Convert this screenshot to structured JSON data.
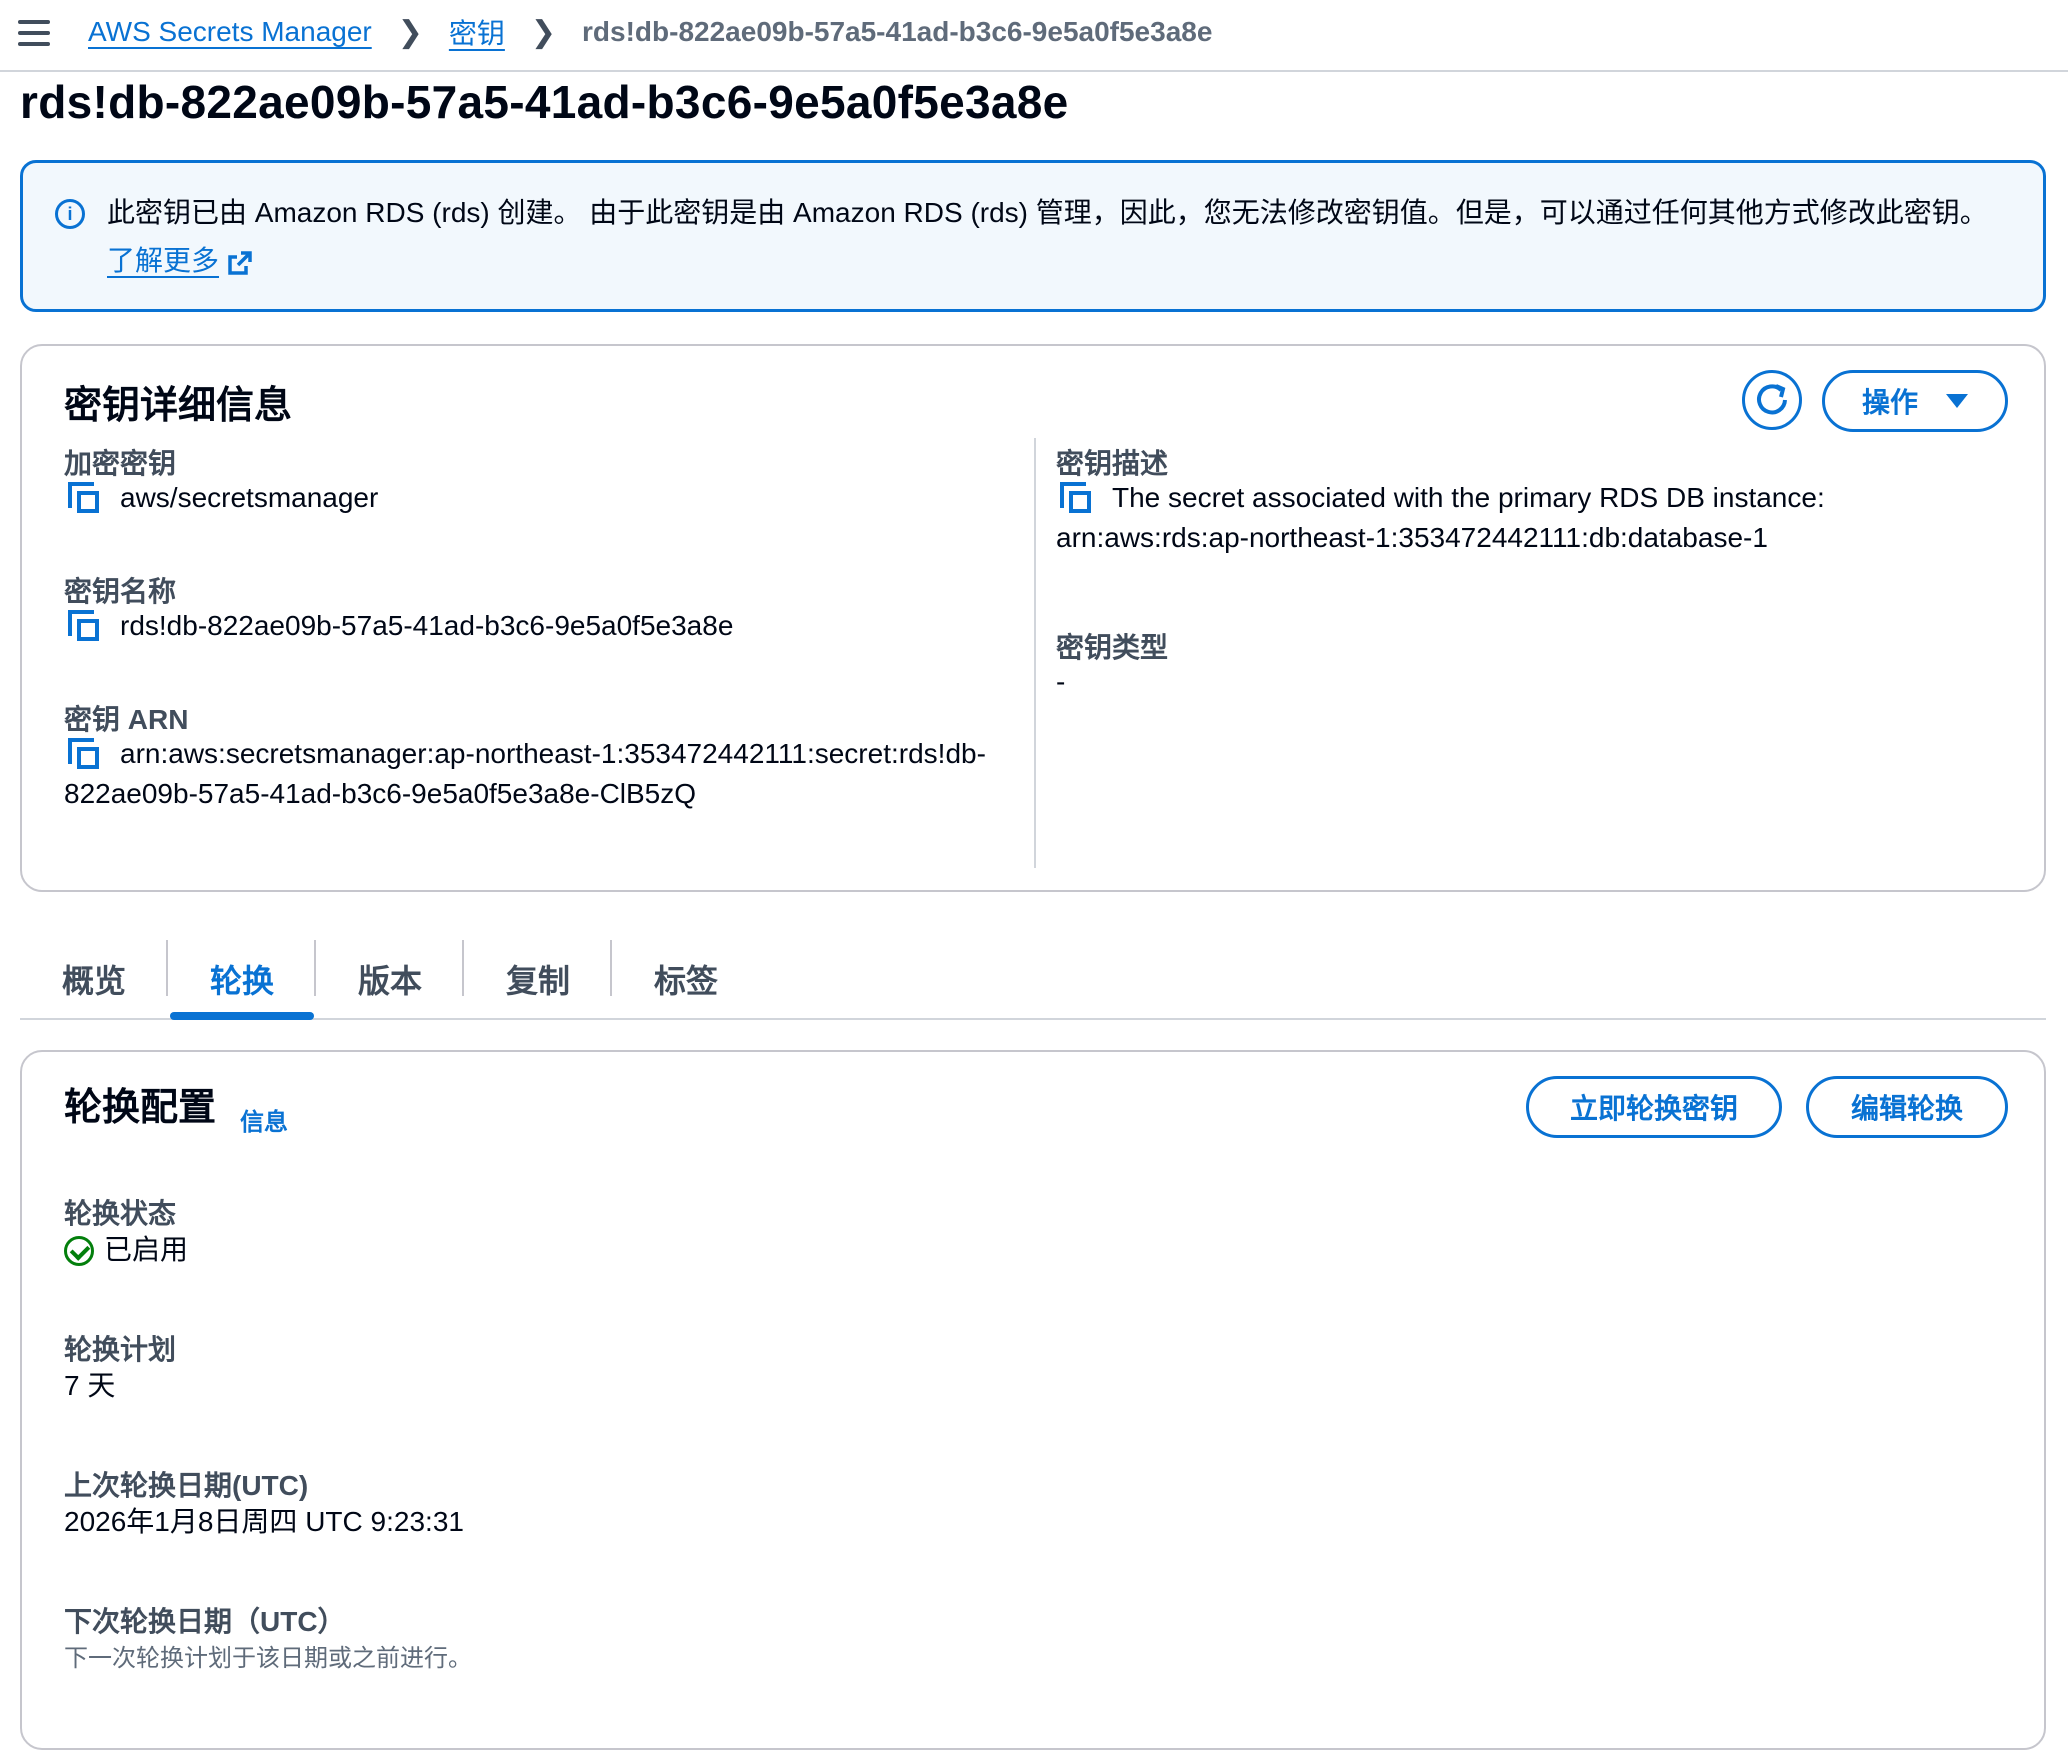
{
  "breadcrumb": {
    "items": [
      "AWS Secrets Manager",
      "密钥"
    ],
    "current": "rds!db-822ae09b-57a5-41ad-b3c6-9e5a0f5e3a8e"
  },
  "page_title": "rds!db-822ae09b-57a5-41ad-b3c6-9e5a0f5e3a8e",
  "banner": {
    "text": "此密钥已由 Amazon RDS (rds) 创建。 由于此密钥是由 Amazon RDS (rds) 管理，因此，您无法修改密钥值。但是，可以通过任何其他方式修改此密钥。",
    "link": "了解更多"
  },
  "details": {
    "title": "密钥详细信息",
    "actions_label": "操作",
    "encryption_key": {
      "label": "加密密钥",
      "value": "aws/secretsmanager"
    },
    "secret_name": {
      "label": "密钥名称",
      "value": "rds!db-822ae09b-57a5-41ad-b3c6-9e5a0f5e3a8e"
    },
    "secret_arn": {
      "label": "密钥 ARN",
      "value_line1": "arn:aws:secretsmanager:ap-northeast-1:353472442111:secret:rds!db-",
      "value_line2": "822ae09b-57a5-41ad-b3c6-9e5a0f5e3a8e-ClB5zQ"
    },
    "description": {
      "label": "密钥描述",
      "value_line1": "The secret associated with the primary RDS DB instance:",
      "value_line2": "arn:aws:rds:ap-northeast-1:353472442111:db:database-1"
    },
    "secret_type": {
      "label": "密钥类型",
      "value": "-"
    }
  },
  "tabs": [
    {
      "label": "概览"
    },
    {
      "label": "轮换"
    },
    {
      "label": "版本"
    },
    {
      "label": "复制"
    },
    {
      "label": "标签"
    }
  ],
  "rotation": {
    "title": "轮换配置",
    "info_link": "信息",
    "rotate_now_label": "立即轮换密钥",
    "edit_label": "编辑轮换",
    "status": {
      "label": "轮换状态",
      "value": "已启用"
    },
    "schedule": {
      "label": "轮换计划",
      "value": "7 天"
    },
    "last_rotated": {
      "label": "上次轮换日期(UTC)",
      "value": "2026年1月8日周四 UTC 9:23:31"
    },
    "next_rotation": {
      "label": "下次轮换日期（UTC）",
      "description": "下一次轮换计划于该日期或之前进行。"
    }
  },
  "colors": {
    "accent": "#0972d3",
    "success": "#037f0c",
    "banner_bg": "#f2f8fd"
  }
}
